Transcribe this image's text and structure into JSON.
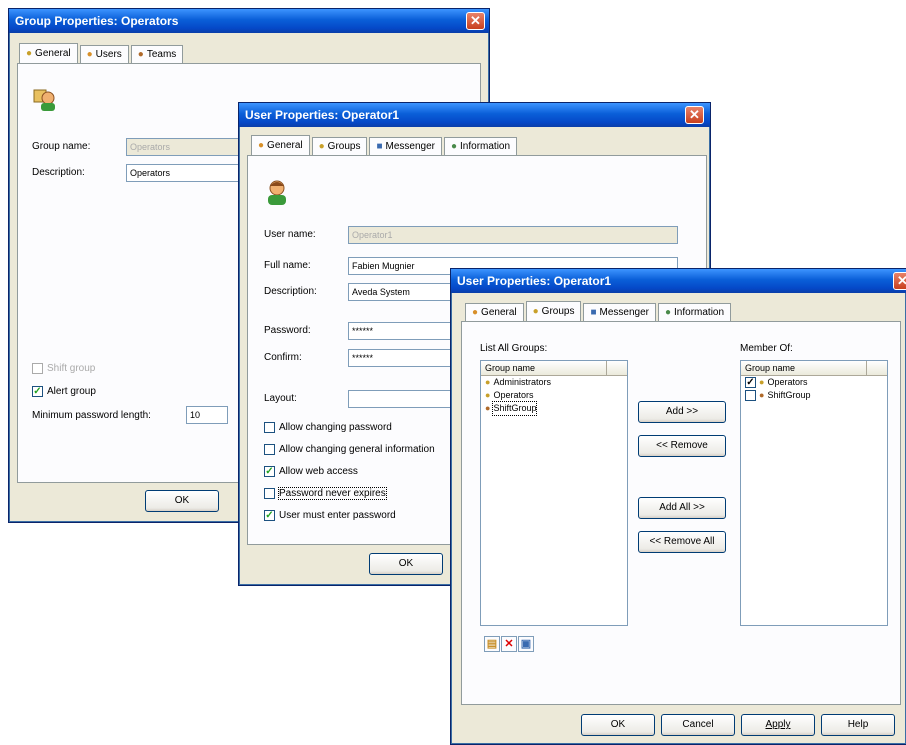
{
  "group_window": {
    "title": "Group Properties: Operators",
    "tabs": [
      "General",
      "Users",
      "Teams"
    ],
    "group_name_label": "Group name:",
    "group_name_value": "Operators",
    "description_label": "Description:",
    "description_value": "Operators",
    "shift_group_label": "Shift group",
    "alert_group_label": "Alert group",
    "min_pw_label": "Minimum password length:",
    "min_pw_value": "10",
    "ok_label": "OK"
  },
  "user_window_1": {
    "title": "User Properties: Operator1",
    "tabs": [
      "General",
      "Groups",
      "Messenger",
      "Information"
    ],
    "user_name_label": "User name:",
    "user_name_value": "Operator1",
    "full_name_label": "Full name:",
    "full_name_value": "Fabien Mugnier",
    "description_label": "Description:",
    "description_value": "Aveda System",
    "password_label": "Password:",
    "password_value": "******",
    "confirm_label": "Confirm:",
    "confirm_value": "******",
    "layout_label": "Layout:",
    "allow_change_pw": "Allow changing password",
    "allow_change_info": "Allow changing general information",
    "allow_web": "Allow web access",
    "pw_never_expires": "Password never expires",
    "must_enter_pw": "User must enter password",
    "ok_label": "OK"
  },
  "user_window_2": {
    "title": "User Properties: Operator1",
    "tabs": [
      "General",
      "Groups",
      "Messenger",
      "Information"
    ],
    "list_all_label": "List All Groups:",
    "member_of_label": "Member Of:",
    "col_header": "Group name",
    "all_groups": [
      "Administrators",
      "Operators",
      "ShiftGroup"
    ],
    "member_groups": [
      "Operators",
      "ShiftGroup"
    ],
    "add_label": "Add >>",
    "remove_label": "<< Remove",
    "add_all_label": "Add All >>",
    "remove_all_label": "<< Remove All",
    "ok_label": "OK",
    "cancel_label": "Cancel",
    "apply_label": "Apply",
    "help_label": "Help"
  },
  "colors": {
    "title_blue": "#0a5fd8",
    "close_red": "#c8401e",
    "window_bg": "#ece9d8"
  }
}
